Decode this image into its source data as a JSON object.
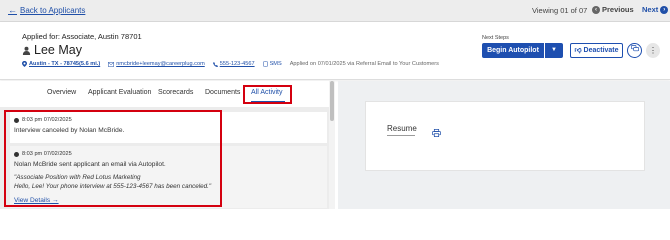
{
  "nav": {
    "back_label": "Back to Applicants",
    "viewing": "Viewing 01 of 07",
    "previous": "Previous",
    "next": "Next"
  },
  "candidate": {
    "applied_for": "Applied for: Associate, Austin 78701",
    "name": "Lee May",
    "location": "Austin - TX - 78745(5.6 mi.)",
    "email": "nmcbride+leemay@careerplug.com",
    "phone": "555-123-4567",
    "sms": "SMS",
    "applied_on": "Applied on 07/01/2025 via Referral Email to Your Customers"
  },
  "next_steps": {
    "label": "Next Steps",
    "begin_autopilot": "Begin Autopilot",
    "deactivate": "Deactivate"
  },
  "tabs": [
    {
      "label": "Overview"
    },
    {
      "label": "Applicant Evaluation"
    },
    {
      "label": "Scorecards"
    },
    {
      "label": "Documents"
    },
    {
      "label": "All Activity",
      "active": true
    }
  ],
  "activities": [
    {
      "time": "8:03 pm 07/02/2025",
      "text": "Interview canceled by Nolan McBride."
    },
    {
      "time": "8:03 pm 07/02/2025",
      "text": "Nolan McBride sent applicant an email via Autopilot.",
      "quote_line1": "\"Associate Position with Red Lotus Marketing",
      "quote_line2": "Hello, Lee! Your phone interview at 555-123-4567 has been canceled.\"",
      "link": "View Details →"
    }
  ],
  "resume": {
    "label": "Resume"
  },
  "colors": {
    "brand_blue": "#1e4fb0",
    "highlight_red": "#d4000f"
  }
}
